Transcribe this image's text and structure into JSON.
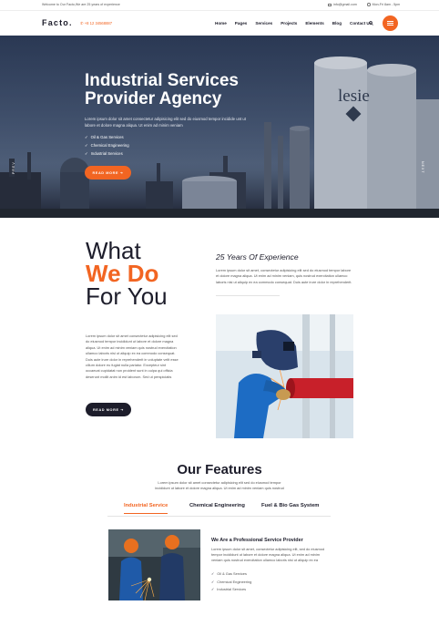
{
  "topbar": {
    "welcome": "Welcome to Our Facto,We are 25 years of experience",
    "email": "info@gmail.com",
    "hours": "Mon-Fri 8am - 5pm"
  },
  "nav": {
    "logo": "Facto.",
    "phone": "+8 12 34568887",
    "items": [
      "Home",
      "Pages",
      "Services",
      "Projects",
      "Elements",
      "Blog",
      "Contact Us"
    ]
  },
  "hero": {
    "title": "Industrial Services Provider Agency",
    "text": "Lorem ipsum dolor sit amet consectetur adipisicing elit sed do eiusmod tempor incidide unt ut labore et dolore magna aliqua. Ut enim ad minim veniam",
    "list": [
      "Oil & Gas Services",
      "Chemical Engineering",
      "Industrial Services"
    ],
    "button": "READ MORE  ➔",
    "prev": "PREV",
    "next": "NEXT"
  },
  "what_we_do": {
    "title_line1": "What",
    "title_accent": "We Do",
    "title_line3": "For You",
    "text": "Lorem ipsum dolor sit amet consectetur adipisicing elit sed do eiusmod tempor incididunt ut labore et dolore magna aliqua. Ut enim ad minim veniam quis nostrud exercitation ullamco laboris nisi ut aliquip ex ea commodo consequat. Duis aute irure dolor in reprehenderit in voluptate velit esse cillum dolore eu fugiat nulla pariatur. Excepteur sint occaecat cupidatat non proident sunt in culpa qui officia deserunt mollit anim id est laborum. Sed ut perspiciatis",
    "button": "READ MORE  ➔",
    "experience_title": "25 Years Of Experience",
    "experience_text": "Lorem ipsum dolor sit amet, consectetur adipisicing elit sed do eiusmod tempor labore et dolore magna aliqua. Ut enim ad minim veniam, quis nostrud exercitation ullamco laboris nisi ut aliquip ex ea commodo consequat. Duis aute irure dolor in reprehenderit."
  },
  "features": {
    "title": "Our Features",
    "text": "Lorem ipsum dolor sit amet consectetur adipisicing elit sed do eiusmod tempor incididunt ut labore et dolore magna aliqua. Ut enim ad minim veniam quis nostrud",
    "tabs": [
      "Industrial Service",
      "Chemical Engineering",
      "Fuel & Bio Gas System"
    ],
    "active_tab": "Industrial Service",
    "subtitle": "We Are a Professional Service Provider",
    "subtext": "Lorem ipsum dolor sit amet, consectetur adipisicing elit, sed do eiusmod tempor incididunt ut labore et dolore magna aliqua. Ut enim ad minim veniam quis nostrud exercitation ullamco laboris nisi ut aliquip ex ea",
    "list": [
      "Oil & Gas Services",
      "Chemical Engineering",
      "Industrial Services"
    ]
  },
  "colors": {
    "accent": "#f26522",
    "dark": "#1d1d2b"
  },
  "icons": [
    "email-icon",
    "clock-icon",
    "phone-icon",
    "search-icon",
    "menu-icon",
    "check-icon",
    "arrow-right-icon"
  ]
}
